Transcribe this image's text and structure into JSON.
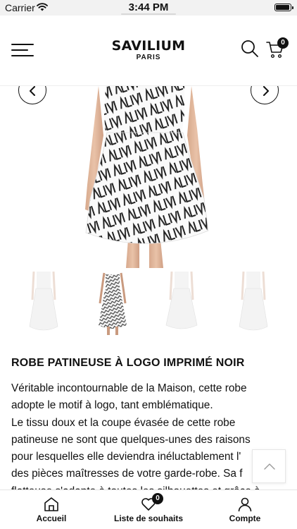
{
  "status_bar": {
    "carrier": "Carrier",
    "time": "3:44 PM"
  },
  "header": {
    "brand": "SAVILIUM",
    "brand_sub": "PARIS",
    "cart_count": "0"
  },
  "product": {
    "title": "ROBE PATINEUSE À LOGO IMPRIMÉ NOIR",
    "description_lines": [
      "Véritable incontournable de la Maison, cette robe",
      "adopte le motif à logo, tant emblématique.",
      "Le tissu doux et la coupe évasée de cette robe",
      "patineuse ne sont que quelques-unes des raisons",
      "pour lesquelles elle deviendra inéluctablement l'",
      "des pièces maîtresses de votre garde-robe. Sa f",
      "flatteuse s'adapte à toutes les silhouettes et grâce à"
    ],
    "selected_thumbnail": 2
  },
  "tab_bar": {
    "home_label": "Accueil",
    "wishlist_label": "Liste de souhaits",
    "wishlist_count": "0",
    "account_label": "Compte"
  }
}
